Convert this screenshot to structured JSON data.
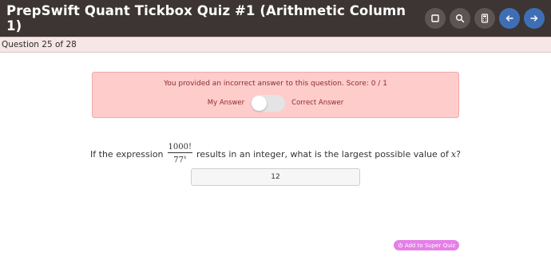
{
  "header": {
    "title": "PrepSwift Quant Tickbox Quiz #1 (Arithmetic Column 1)",
    "buttons": [
      {
        "icon": "square-icon",
        "color": "#5b5553"
      },
      {
        "icon": "search-icon",
        "color": "#5b5553"
      },
      {
        "icon": "calculator-icon",
        "color": "#5b5553"
      },
      {
        "icon": "arrow-left-icon",
        "color": "#3e6fb5"
      },
      {
        "icon": "arrow-right-icon",
        "color": "#3e6fb5"
      }
    ]
  },
  "progress": {
    "label": "Question 25 of 28"
  },
  "feedback": {
    "message": "You provided an incorrect answer to this question. Score: 0 / 1",
    "toggle_left": "My Answer",
    "toggle_right": "Correct Answer",
    "toggle_state": "my-answer"
  },
  "question": {
    "prefix": "If the expression",
    "numerator": "1000!",
    "denominator_base": "77",
    "denominator_exp": "x",
    "suffix": "results in an integer, what is the largest possible value of",
    "variable": "x",
    "end": "?"
  },
  "answer": {
    "value": "12"
  },
  "actions": {
    "super_quiz_label": "Add to Super Quiz"
  },
  "colors": {
    "header_bg": "#3d3533",
    "nav_blue": "#3e6fb5",
    "alert_bg": "#ffcccc",
    "alert_text": "#8a2d2d",
    "super_quiz": "#e67ee8"
  }
}
